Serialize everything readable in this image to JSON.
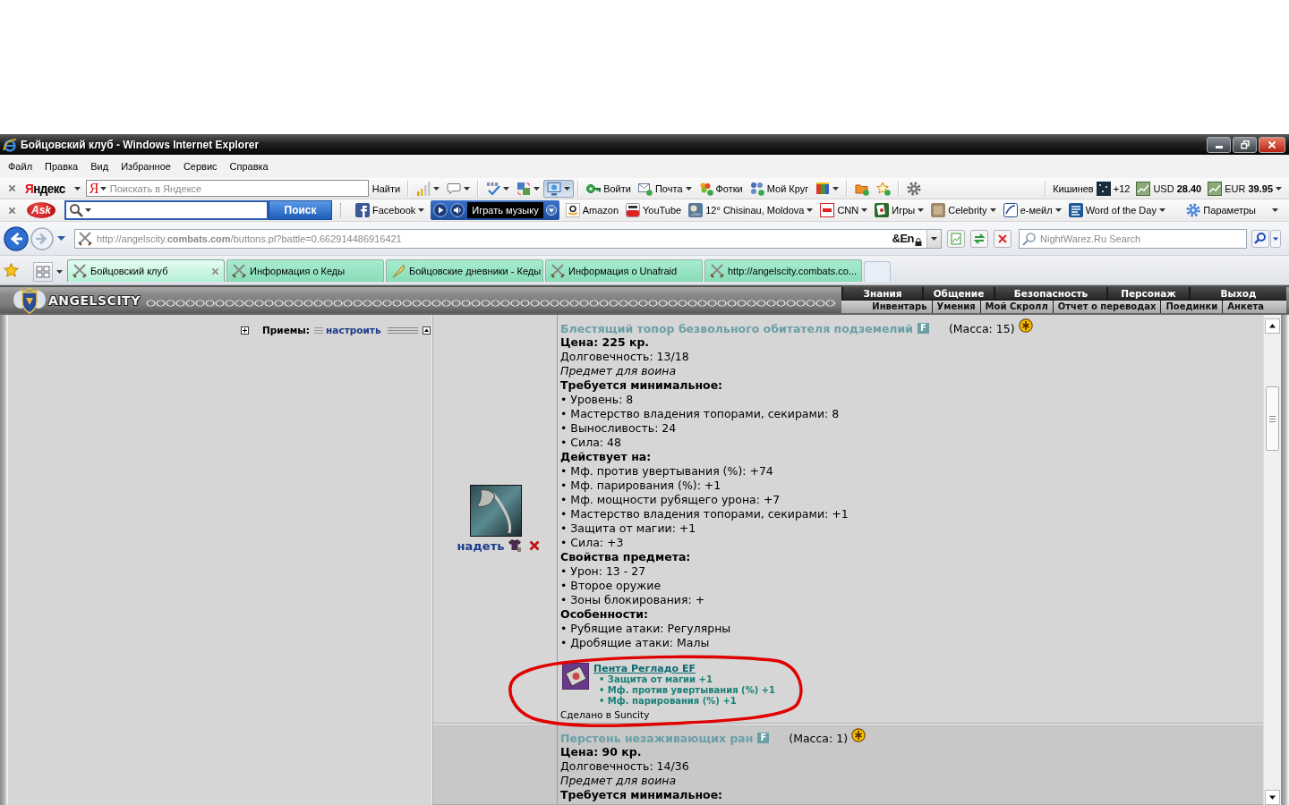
{
  "window": {
    "title": "Бойцовский клуб - Windows Internet Explorer"
  },
  "menu_bar": [
    "Файл",
    "Правка",
    "Вид",
    "Избранное",
    "Сервис",
    "Справка"
  ],
  "yandex_toolbar": {
    "logo": "Яндекс",
    "field_logo": "Я",
    "placeholder": "Поискать в Яндексе",
    "search_button": "Найти",
    "items": [
      {
        "kind": "separator"
      },
      {
        "kind": "signal",
        "dropdown": true,
        "pressed": false
      },
      {
        "kind": "bubble",
        "dropdown": true,
        "pressed": false
      },
      {
        "kind": "separator"
      },
      {
        "kind": "spellcheck",
        "dropdown": true,
        "pressed": false
      },
      {
        "kind": "translate",
        "dropdown": true,
        "pressed": false
      },
      {
        "kind": "monitor",
        "dropdown": true,
        "pressed": true
      },
      {
        "kind": "separator"
      },
      {
        "kind": "key",
        "label": "Войти",
        "dropdown": false,
        "pressed": false
      },
      {
        "kind": "mail",
        "label": "Почта",
        "dropdown": true,
        "pressed": false
      },
      {
        "kind": "photos",
        "label": "Фотки",
        "dropdown": false,
        "pressed": false
      },
      {
        "kind": "circles",
        "label": "Мой Круг",
        "dropdown": false,
        "pressed": false
      },
      {
        "kind": "cube",
        "dropdown": true,
        "pressed": false
      },
      {
        "kind": "separator"
      },
      {
        "kind": "folder",
        "dropdown": false,
        "pressed": false
      },
      {
        "kind": "star",
        "dropdown": false,
        "pressed": false
      },
      {
        "kind": "separator"
      },
      {
        "kind": "gear",
        "dropdown": false,
        "pressed": false
      }
    ],
    "city": "Кишинев",
    "temperature": "+12",
    "rates": [
      "USD **28.40**",
      "EUR **39.95**"
    ]
  },
  "ask_toolbar": {
    "logo": "Ask",
    "search_button": "Поиск",
    "items": [
      {
        "kind": "facebook",
        "label": "Facebook",
        "dropdown": true
      },
      {
        "kind": "player",
        "label": "Играть музыку",
        "dropdown": true
      },
      {
        "kind": "amazon",
        "label": "Amazon",
        "dropdown": false
      },
      {
        "kind": "youtube",
        "label": "YouTube",
        "dropdown": false
      },
      {
        "kind": "weather",
        "label": "12° Chisinau, Moldova",
        "dropdown": true
      },
      {
        "kind": "news",
        "label": "CNN",
        "dropdown": true
      },
      {
        "kind": "cards",
        "label": "Игры",
        "dropdown": true
      },
      {
        "kind": "picture",
        "label": "Celebrity",
        "dropdown": true
      },
      {
        "kind": "email",
        "label": "e-мейл",
        "dropdown": true
      },
      {
        "kind": "book",
        "label": "Word of the Day",
        "dropdown": true
      }
    ],
    "settings": "Параметры"
  },
  "address_bar": {
    "url": "http://angelscity.**combats.com**/buttons.pl?battle=0.662914486916421",
    "language": "&En",
    "search": {
      "placeholder": "NightWarez.Ru Search"
    }
  },
  "tabs": [
    {
      "title": "Бойцовский клуб",
      "kind": "swords",
      "selected": true
    },
    {
      "title": "Информация о Кеды",
      "kind": "swords",
      "selected": false
    },
    {
      "title": "Бойцовские дневники - Кеды",
      "kind": "quill",
      "selected": false
    },
    {
      "title": "Информация о Unafraid",
      "kind": "swords",
      "selected": false
    },
    {
      "title": "http://angelscity.combats.co...",
      "kind": "swords",
      "selected": false
    }
  ],
  "site": {
    "logo": "ANGELSCITY",
    "nav_top": [
      "Знания",
      "Общение",
      "Безопасность",
      "Персонаж",
      "Выход"
    ],
    "nav_bottom": [
      "Инвентарь",
      "Умения",
      "Мой Скролл",
      "Отчет о переводах",
      "Поединки",
      "Анкета"
    ]
  },
  "left_panel": {
    "label": "Приемы:",
    "link": "настроить"
  },
  "items": [
    {
      "kind": "axe",
      "name": "Блестящий топор безвольного обитателя подземелий",
      "badge": "F",
      "mass": "(Масса: 15)",
      "action": "надеть",
      "lines": [
        {
          "kind": "bold",
          "text": "Цена: 225 кр."
        },
        {
          "kind": "plain",
          "text": "Долговечность: 13/18"
        },
        {
          "kind": "italic",
          "text": "Предмет для воина"
        },
        {
          "kind": "heading",
          "text": "Требуется минимальное:"
        },
        {
          "kind": "plain",
          "text": "• Уровень: 8"
        },
        {
          "kind": "plain",
          "text": "• Мастерство владения топорами, секирами: 8"
        },
        {
          "kind": "plain",
          "text": "• Выносливость: 24"
        },
        {
          "kind": "plain",
          "text": "• Сила: 48"
        },
        {
          "kind": "heading",
          "text": "Действует на:"
        },
        {
          "kind": "plain",
          "text": "• Мф. против увертывания (%): +74"
        },
        {
          "kind": "plain",
          "text": "• Мф. парирования (%): +1"
        },
        {
          "kind": "plain",
          "text": "• Мф. мощности рубящего урона: +7"
        },
        {
          "kind": "plain",
          "text": "• Мастерство владения топорами, секирами: +1"
        },
        {
          "kind": "plain",
          "text": "• Защита от магии: +1"
        },
        {
          "kind": "plain",
          "text": "• Сила: +3"
        },
        {
          "kind": "heading",
          "text": "Свойства предмета:"
        },
        {
          "kind": "plain",
          "text": "• Урон: 13 - 27"
        },
        {
          "kind": "plain",
          "text": "• Второе оружие"
        },
        {
          "kind": "plain",
          "text": "• Зоны блокирования: +"
        },
        {
          "kind": "heading",
          "text": "Особенности:"
        },
        {
          "kind": "plain",
          "text": "• Рубящие атаки: Регулярны"
        },
        {
          "kind": "plain",
          "text": "• Дробящие атаки: Малы"
        }
      ],
      "rune": {
        "name": "Пента Регладо EF",
        "bonuses": [
          "• Защита от магии +1",
          "• Мф. против увертывания (%) +1",
          "• Мф. парирования (%) +1"
        ],
        "highlighted": true
      },
      "origin": "Сделано в Suncity"
    },
    {
      "kind": "ring",
      "name": "Перстень незаживающих ран",
      "badge": "F",
      "mass": "(Масса: 1)",
      "lines": [
        {
          "kind": "bold",
          "text": "Цена: 90 кр."
        },
        {
          "kind": "plain",
          "text": "Долговечность: 14/36"
        },
        {
          "kind": "italic",
          "text": "Предмет для воина"
        },
        {
          "kind": "heading",
          "text": "Требуется минимальное:"
        }
      ]
    }
  ]
}
